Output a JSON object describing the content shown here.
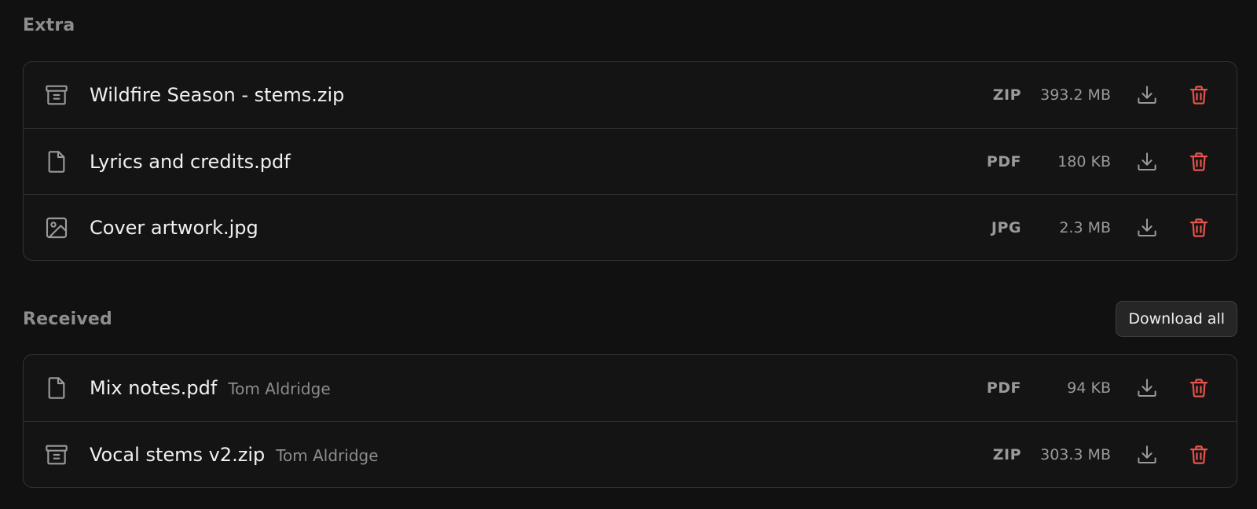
{
  "sections": {
    "extra": {
      "title": "Extra",
      "files": [
        {
          "name": "Wildfire Season - stems.zip",
          "owner": "",
          "type": "ZIP",
          "size": "393.2 MB",
          "icon": "archive-icon"
        },
        {
          "name": "Lyrics and credits.pdf",
          "owner": "",
          "type": "PDF",
          "size": "180 KB",
          "icon": "file-icon"
        },
        {
          "name": "Cover artwork.jpg",
          "owner": "",
          "type": "JPG",
          "size": "2.3 MB",
          "icon": "image-icon"
        }
      ]
    },
    "received": {
      "title": "Received",
      "download_all_label": "Download all",
      "files": [
        {
          "name": "Mix notes.pdf",
          "owner": "Tom Aldridge",
          "type": "PDF",
          "size": "94 KB",
          "icon": "file-icon"
        },
        {
          "name": "Vocal stems v2.zip",
          "owner": "Tom Aldridge",
          "type": "ZIP",
          "size": "303.3 MB",
          "icon": "archive-icon"
        }
      ]
    }
  },
  "colors": {
    "background": "#111111",
    "card_border": "#333333",
    "section_title": "#8e8e8e",
    "delete_accent": "#e5534b",
    "icon_gray": "#9a9a9a"
  }
}
